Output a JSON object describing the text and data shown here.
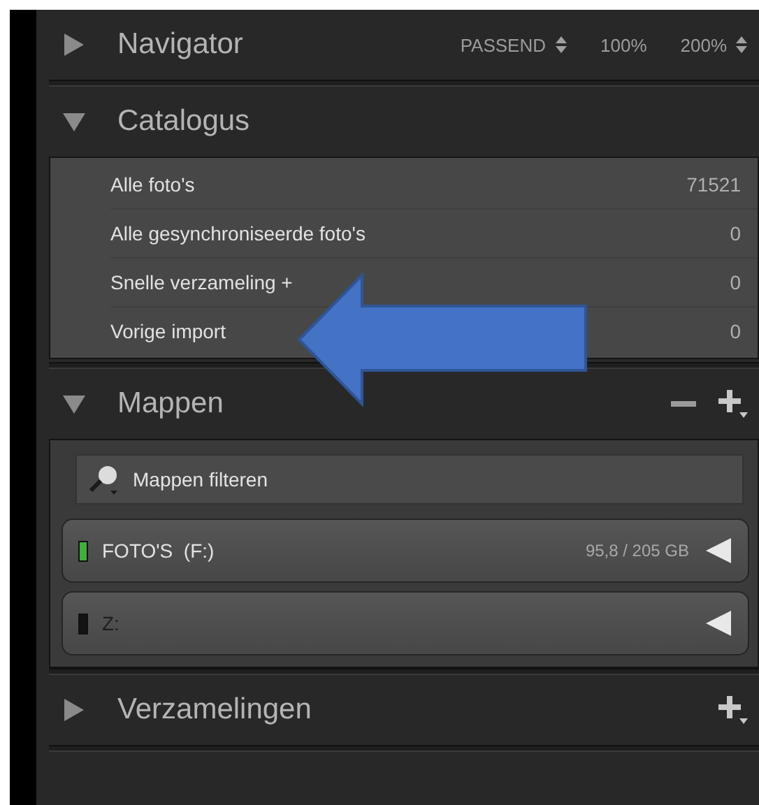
{
  "sections": [
    {
      "kind": "navigator",
      "title": "Navigator",
      "expanded": false,
      "zoom_options": [
        {
          "kind": "option",
          "label": "PASSEND"
        },
        {
          "kind": "stepper"
        },
        {
          "kind": "option",
          "label": "100%"
        },
        {
          "kind": "option",
          "label": "200%"
        },
        {
          "kind": "stepper"
        }
      ]
    },
    {
      "kind": "catalog",
      "title": "Catalogus",
      "expanded": true,
      "items": [
        {
          "name": "Alle foto's",
          "count": "71521"
        },
        {
          "name": "Alle gesynchroniseerde foto's",
          "count": "0"
        },
        {
          "name": "Snelle verzameling +",
          "count": "0"
        },
        {
          "name": "Vorige import",
          "count": "0"
        }
      ]
    },
    {
      "kind": "folders",
      "title": "Mappen",
      "expanded": true,
      "tools": [
        {
          "kind": "minus"
        },
        {
          "kind": "add"
        }
      ],
      "filter": {
        "placeholder": "Mappen filteren"
      },
      "drives": [
        {
          "name": "FOTO'S  (F:)",
          "usage": "95,8 / 205 GB",
          "color": "#3fae3f"
        },
        {
          "name": "Z:",
          "color": "#141414"
        }
      ]
    },
    {
      "kind": "collections",
      "title": "Verzamelingen",
      "expanded": false,
      "tools": [
        {
          "kind": "add"
        }
      ]
    }
  ],
  "annotation": {
    "kind": "arrow"
  }
}
